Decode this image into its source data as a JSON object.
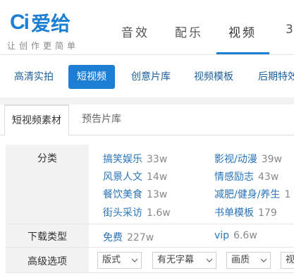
{
  "brand": {
    "logo_mark": "Ci",
    "logo_text": "爱给",
    "slogan": "让创作更简单"
  },
  "main_nav": [
    {
      "label": "音效"
    },
    {
      "label": "配乐"
    },
    {
      "label": "视频"
    },
    {
      "label": "3"
    }
  ],
  "sub_nav": [
    {
      "label": "高清实拍"
    },
    {
      "label": "短视频"
    },
    {
      "label": "创意片库"
    },
    {
      "label": "视频模板"
    },
    {
      "label": "后期特效"
    }
  ],
  "content_tabs": [
    {
      "label": "短视频素材"
    },
    {
      "label": "预告片库"
    }
  ],
  "filters": {
    "category": {
      "label": "分类",
      "items": [
        {
          "name": "搞笑娱乐",
          "count": "33w"
        },
        {
          "name": "影视/动漫",
          "count": "39w"
        },
        {
          "name": "风景人文",
          "count": "14w"
        },
        {
          "name": "情感励志",
          "count": "43w"
        },
        {
          "name": "餐饮美食",
          "count": "13w"
        },
        {
          "name": "减肥/健身/养生",
          "count": "1"
        },
        {
          "name": "街头采访",
          "count": "1.6w"
        },
        {
          "name": "书单模板",
          "count": "179"
        }
      ]
    },
    "download_type": {
      "label": "下载类型",
      "items": [
        {
          "name": "免费",
          "count": "227w"
        },
        {
          "name": "vip",
          "count": "6.6w"
        }
      ]
    },
    "advanced": {
      "label": "高级选项",
      "selects": [
        {
          "value": "版式"
        },
        {
          "value": "有无字幕"
        },
        {
          "value": "画质"
        },
        {
          "value": "视"
        }
      ]
    }
  },
  "colors": {
    "accent": "#1d7fd4",
    "link": "#2a73b8",
    "label_bg": "#f2f2f2"
  }
}
